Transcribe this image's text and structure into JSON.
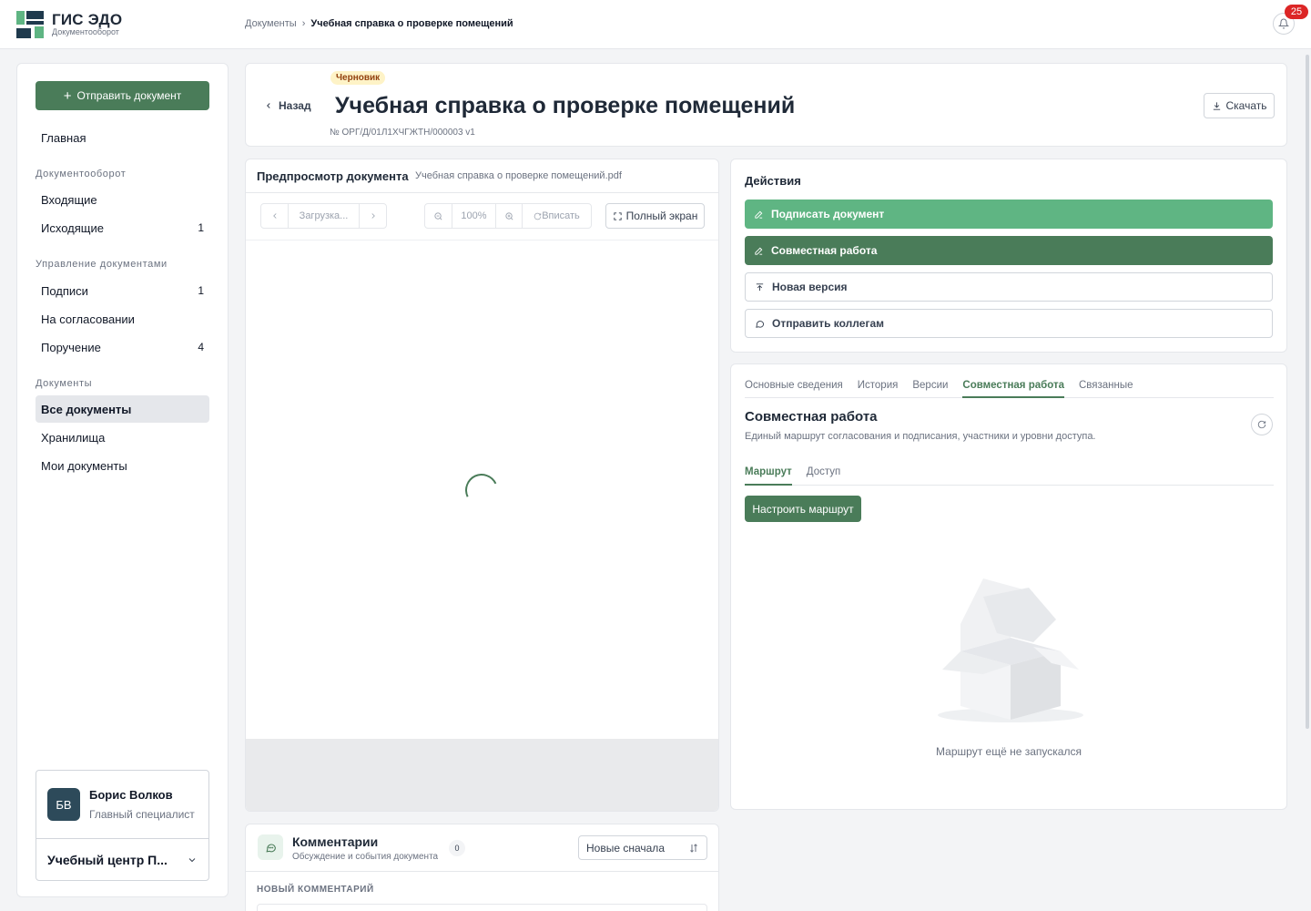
{
  "header": {
    "logo_title": "ГИС ЭДО",
    "logo_subtitle": "Документооборот",
    "breadcrumb": [
      "Документы",
      "Учебная справка о проверке помещений"
    ],
    "breadcrumb_separator": "›",
    "notifications_count": "25"
  },
  "sidebar": {
    "send_button": "Отправить документ",
    "home": "Главная",
    "sections": [
      {
        "title": "Документооборот",
        "items": [
          {
            "label": "Входящие",
            "count": ""
          },
          {
            "label": "Исходящие",
            "count": "1"
          }
        ]
      },
      {
        "title": "Управление документами",
        "items": [
          {
            "label": "Подписи",
            "count": "1"
          },
          {
            "label": "На согласовании",
            "count": ""
          },
          {
            "label": "Поручение",
            "count": "4"
          }
        ]
      },
      {
        "title": "Документы",
        "items": [
          {
            "label": "Все документы",
            "count": "",
            "active": true
          },
          {
            "label": "Хранилища",
            "count": ""
          },
          {
            "label": "Мои документы",
            "count": ""
          }
        ]
      }
    ],
    "user": {
      "initials": "БВ",
      "name": "Борис Волков",
      "role": "Главный специалист",
      "org": "Учебный центр П..."
    }
  },
  "document": {
    "back": "Назад",
    "status": "Черновик",
    "title": "Учебная справка о проверке помещений",
    "number": "№ ОРГ/Д/01Л1ХЧГЖТН/000003  v1",
    "download": "Скачать"
  },
  "preview": {
    "title": "Предпросмотр документа",
    "filename": "Учебная справка о проверке помещений.pdf",
    "page_field": "Загрузка...",
    "zoom": "100%",
    "fit": "Вписать",
    "fullscreen": "Полный экран"
  },
  "comments": {
    "title": "Комментарии",
    "subtitle": "Обсуждение и события документа",
    "count": "0",
    "sort": "Новые сначала",
    "new_label": "НОВЫЙ КОММЕНТАРИЙ"
  },
  "actions": {
    "title": "Действия",
    "buttons": [
      "Подписать документ",
      "Совместная работа",
      "Новая версия",
      "Отправить коллегам"
    ]
  },
  "tabs": {
    "items": [
      "Основные сведения",
      "История",
      "Версии",
      "Совместная работа",
      "Связанные"
    ],
    "active": "Совместная работа"
  },
  "collab": {
    "title": "Совместная работа",
    "description": "Единый маршрут согласования и подписания, участники и уровни доступа.",
    "subtabs": [
      "Маршрут",
      "Доступ"
    ],
    "route_button": "Настроить маршрут",
    "empty_text": "Маршрут ещё не запускался"
  },
  "colors": {
    "accent": "#4a7c59",
    "accent_light": "#5fb583",
    "badge": "#dc2626",
    "draft_bg": "#fef3c7"
  }
}
